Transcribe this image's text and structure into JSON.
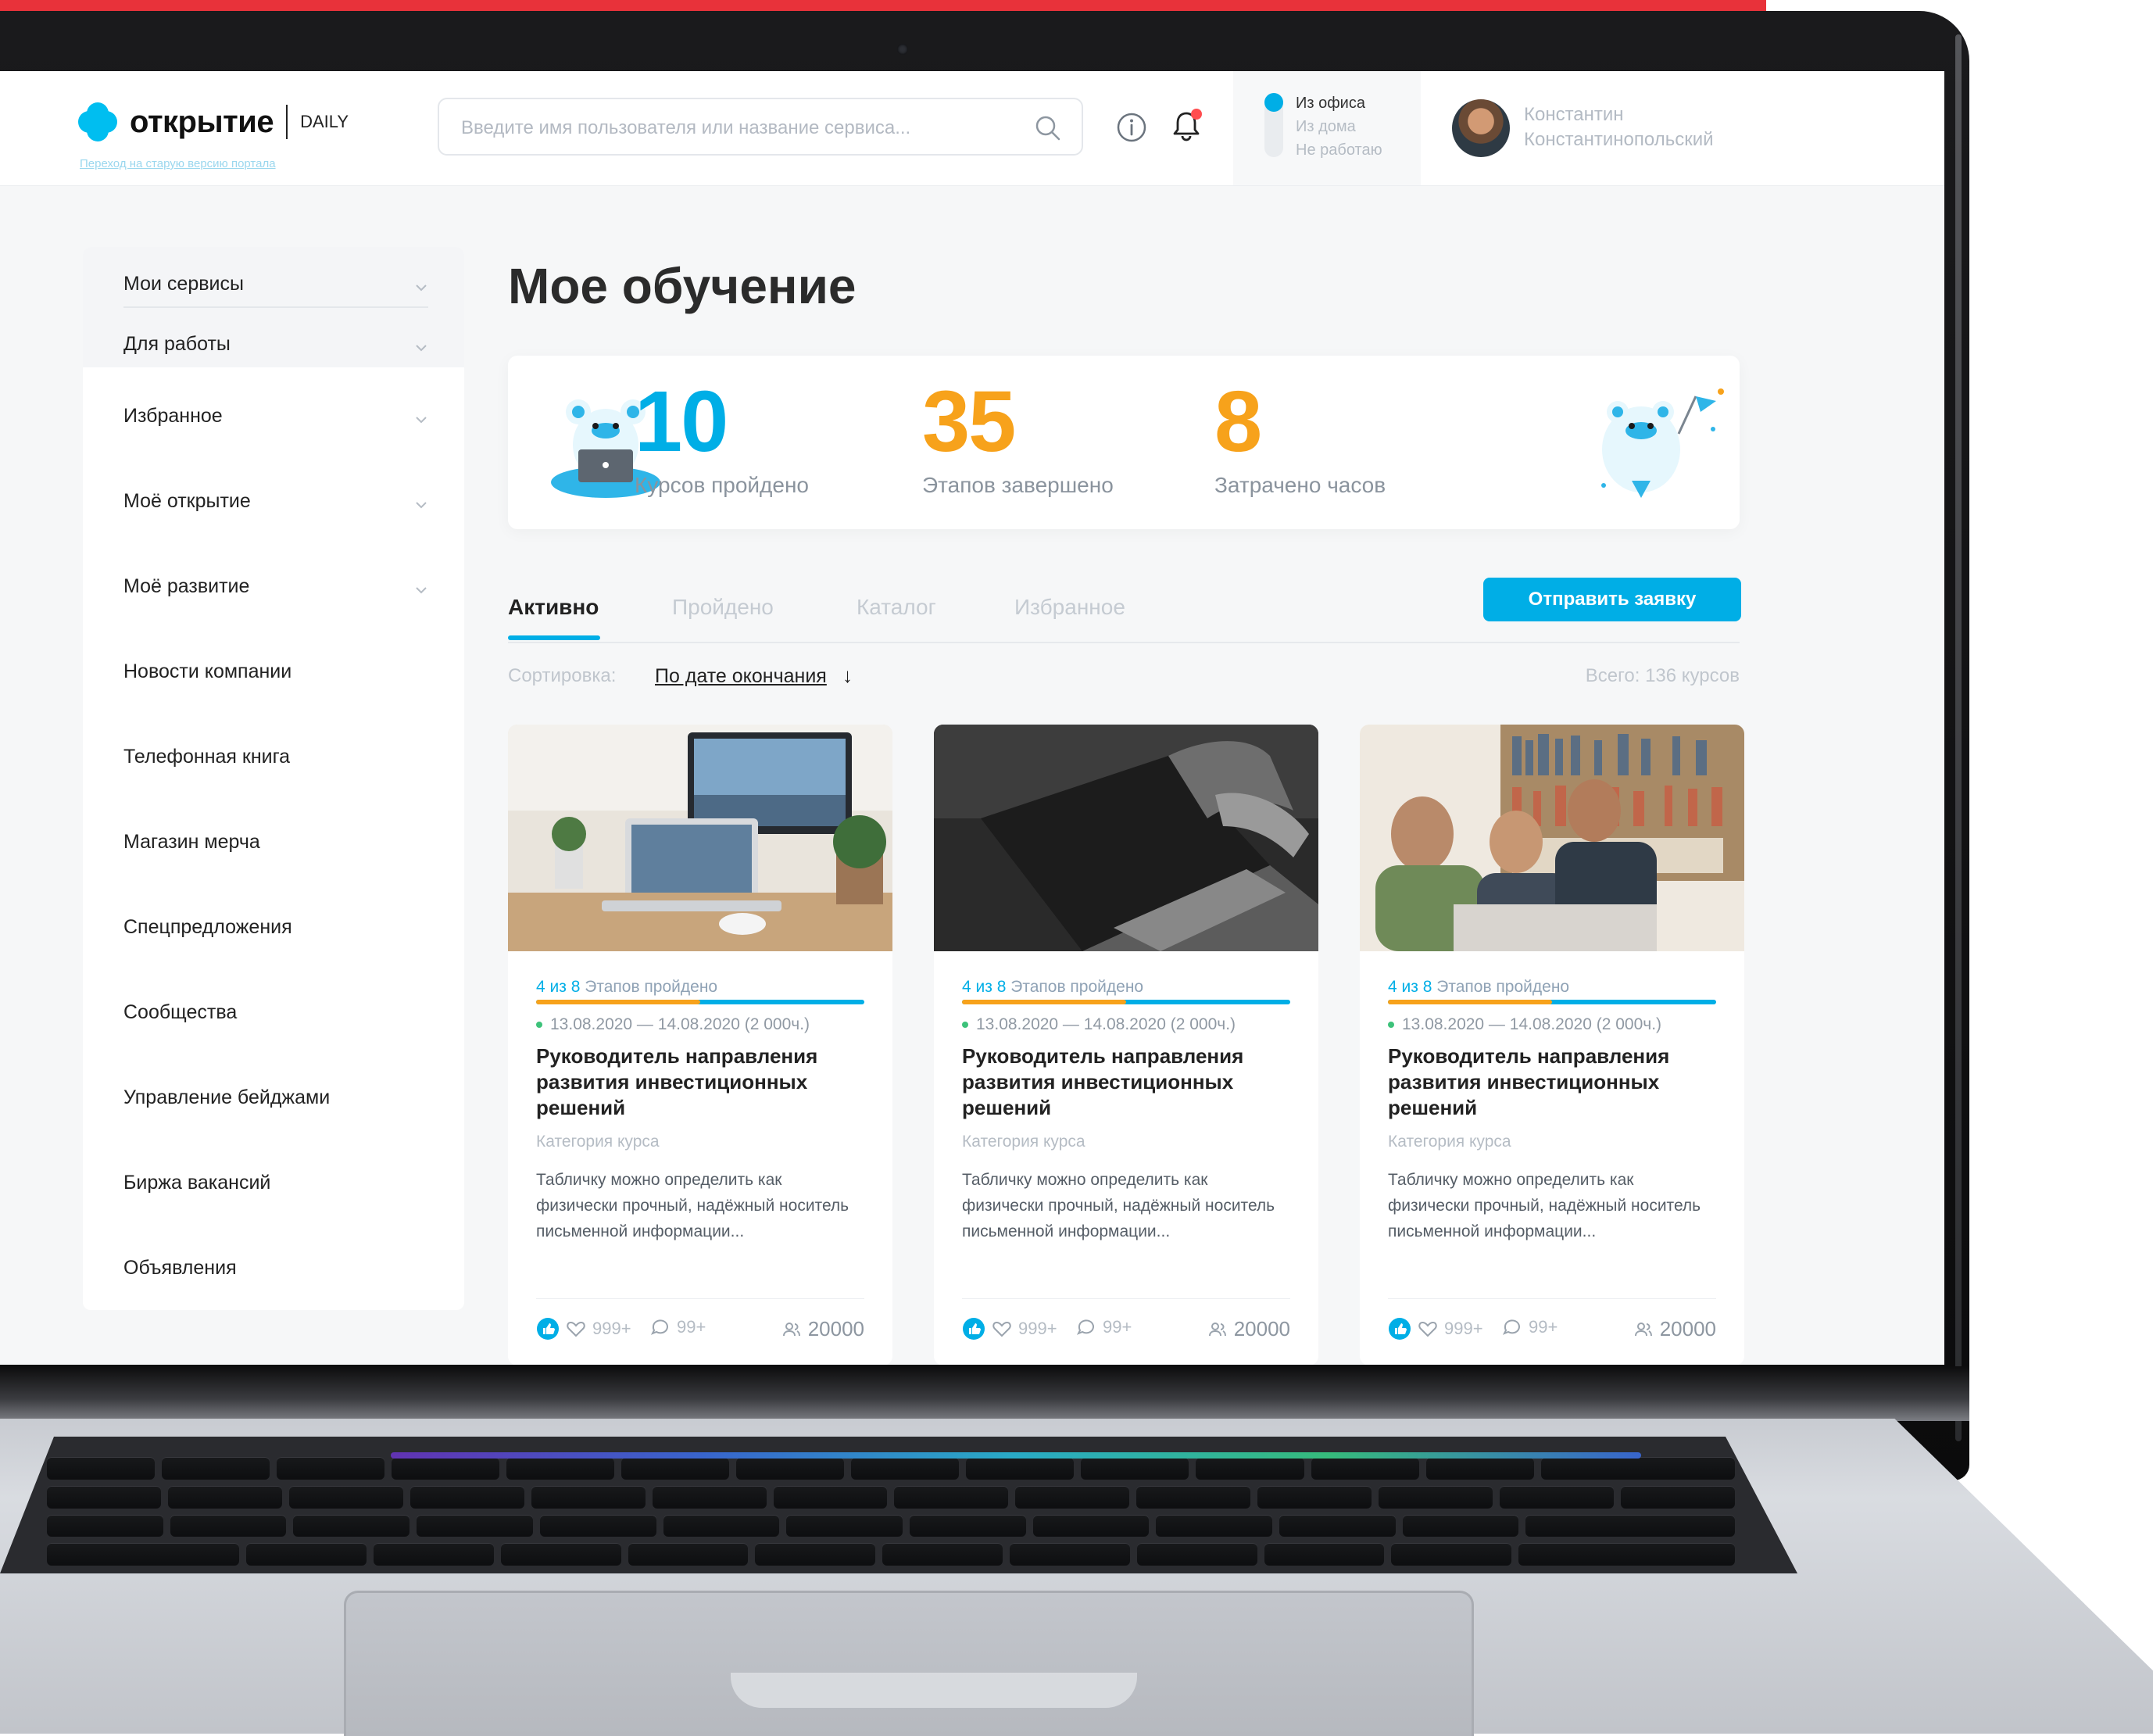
{
  "brand": {
    "name": "открытие",
    "product": "DAILY",
    "old_portal_link": "Переход на старую версию портала"
  },
  "search": {
    "placeholder": "Введите имя пользователя или название сервиса..."
  },
  "work_status": {
    "options": [
      "Из офиса",
      "Из дома",
      "Не работаю"
    ],
    "selected": "Из офиса"
  },
  "user": {
    "first_name": "Константин",
    "last_name": "Константинопольский"
  },
  "sidebar": {
    "items": [
      {
        "label": "Мои сервисы",
        "has_chevron": true
      },
      {
        "label": "Для работы",
        "has_chevron": true
      },
      {
        "label": "Избранное",
        "has_chevron": true
      },
      {
        "label": "Моё открытие",
        "has_chevron": true
      },
      {
        "label": "Моё развитие",
        "has_chevron": true
      },
      {
        "label": "Новости компании",
        "has_chevron": false
      },
      {
        "label": "Телефонная книга",
        "has_chevron": false
      },
      {
        "label": "Магазин мерча",
        "has_chevron": false
      },
      {
        "label": "Спецпредложения",
        "has_chevron": false
      },
      {
        "label": "Сообщества",
        "has_chevron": false
      },
      {
        "label": "Управление бейджами",
        "has_chevron": false
      },
      {
        "label": "Биржа вакансий",
        "has_chevron": false
      },
      {
        "label": "Объявления",
        "has_chevron": false
      }
    ]
  },
  "page": {
    "title": "Мое обучение"
  },
  "stats": [
    {
      "value": "10",
      "label": "Курсов пройдено",
      "color": "#00aee6"
    },
    {
      "value": "35",
      "label": "Этапов завершено",
      "color": "#f7a21b"
    },
    {
      "value": "8",
      "label": "Затрачено часов",
      "color": "#f7a21b"
    }
  ],
  "tabs": [
    {
      "label": "Активно",
      "active": true
    },
    {
      "label": "Пройдено",
      "active": false
    },
    {
      "label": "Каталог",
      "active": false
    },
    {
      "label": "Избранное",
      "active": false
    }
  ],
  "submit_button": "Отправить заявку",
  "sort": {
    "label": "Сортировка:",
    "value": "По дате окончания",
    "arrow": "↓"
  },
  "total": "Всего: 136 курсов",
  "cards": [
    {
      "image": "desk-workspace-photo",
      "progress_count": "4 из 8",
      "progress_text": "Этапов пройдено",
      "progress_fraction": 0.5,
      "dates": "13.08.2020 — 14.08.2020 (2 000ч.)",
      "title": "Руководитель направления развития инвестиционных решений",
      "category": "Категория курса",
      "description": "Табличку можно определить как физически прочный, надёжный носитель письменной информации...",
      "likes": "999+",
      "comments": "99+",
      "participants": "20000"
    },
    {
      "image": "laptop-hands-photo",
      "progress_count": "4 из 8",
      "progress_text": "Этапов пройдено",
      "progress_fraction": 0.5,
      "dates": "13.08.2020 — 14.08.2020 (2 000ч.)",
      "title": "Руководитель направления развития инвестиционных решений",
      "category": "Категория курса",
      "description": "Табличку можно определить как физически прочный, надёжный носитель письменной информации...",
      "likes": "999+",
      "comments": "99+",
      "participants": "20000"
    },
    {
      "image": "team-library-photo",
      "progress_count": "4 из 8",
      "progress_text": "Этапов пройдено",
      "progress_fraction": 0.5,
      "dates": "13.08.2020 — 14.08.2020 (2 000ч.)",
      "title": "Руководитель направления развития инвестиционных решений",
      "category": "Категория курса",
      "description": "Табличку можно определить как физически прочный, надёжный носитель письменной информации...",
      "likes": "999+",
      "comments": "99+",
      "participants": "20000"
    }
  ],
  "colors": {
    "accent": "#00aee6",
    "orange": "#f7a21b",
    "background": "#f6f7f8"
  }
}
